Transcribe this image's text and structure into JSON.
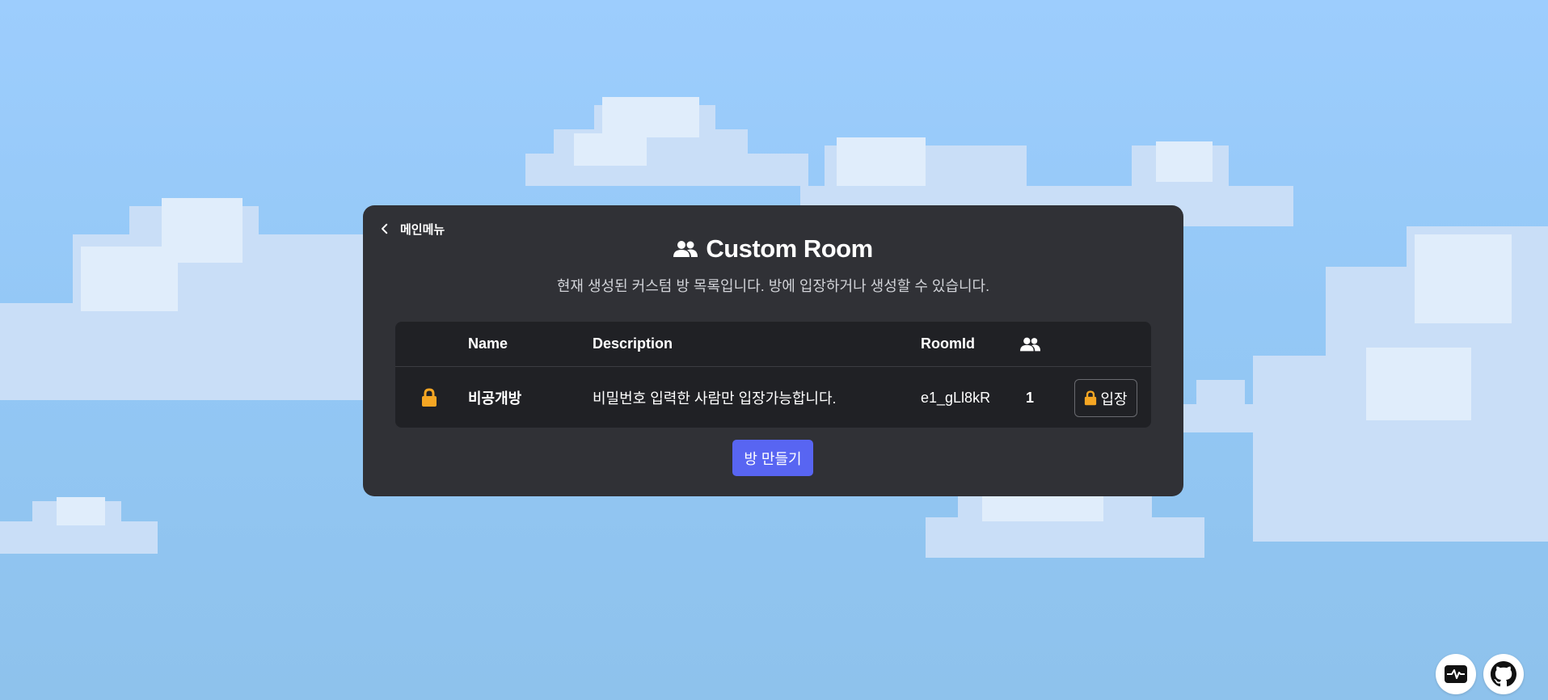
{
  "back": {
    "label": "메인메뉴",
    "icon": "chevron-left-icon"
  },
  "header": {
    "title": "Custom Room",
    "title_icon": "users-icon",
    "subtitle": "현재 생성된 커스텀 방 목록입니다. 방에 입장하거나 생성할 수 있습니다."
  },
  "table": {
    "columns": {
      "name": "Name",
      "description": "Description",
      "room_id": "RoomId",
      "players_icon": "users-icon"
    },
    "rows": [
      {
        "locked": true,
        "lock_icon": "lock-icon",
        "name": "비공개방",
        "description": "비밀번호 입력한 사람만 입장가능합니다.",
        "room_id": "e1_gLl8kR",
        "players": "1",
        "enter_label": "입장"
      }
    ]
  },
  "create_button": {
    "label": "방 만들기"
  },
  "footer": {
    "activity_icon": "activity-icon",
    "github_icon": "github-icon"
  },
  "colors": {
    "sky": "#9dcdfd",
    "panel": "#303136",
    "table": "#202125",
    "accent": "#5865f2",
    "lock": "#f5a623"
  }
}
